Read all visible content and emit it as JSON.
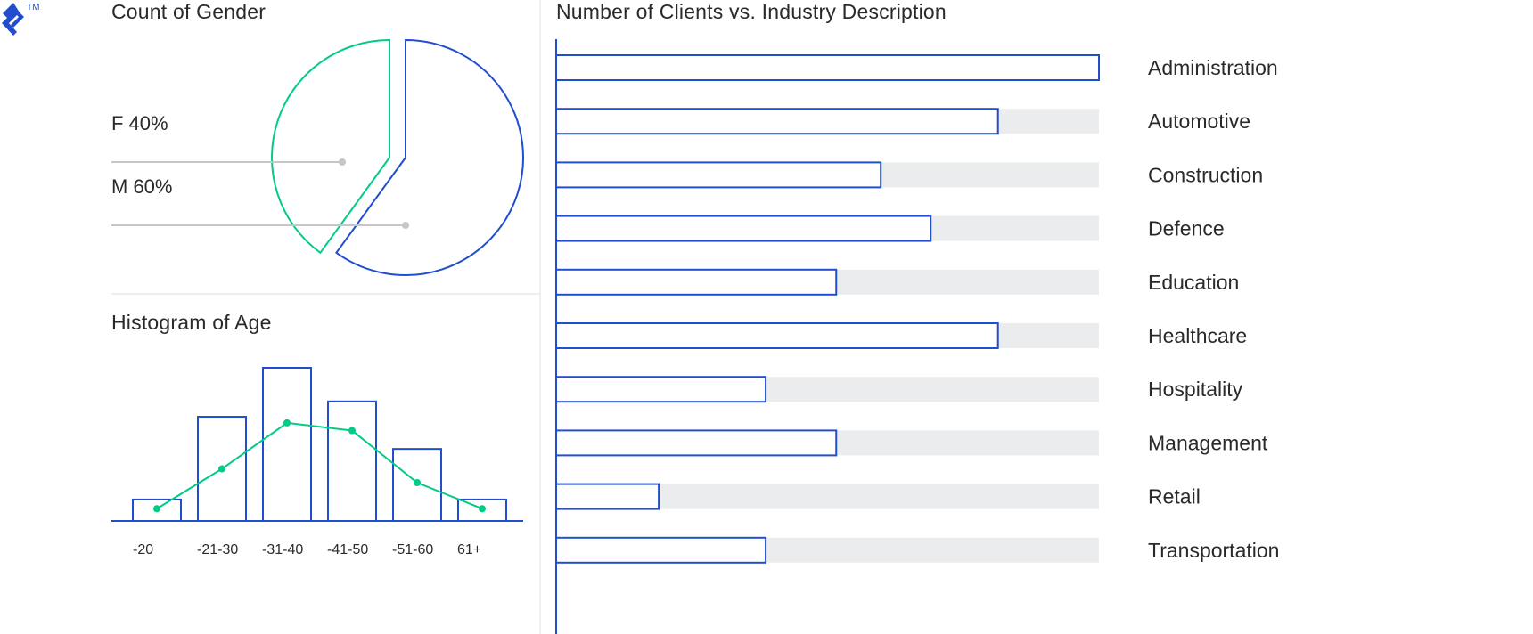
{
  "brand": {
    "logo_icon": "toptal-logo-icon",
    "trademark": "TM"
  },
  "colors": {
    "blue": "#204ECF",
    "green": "#00CC83",
    "track": "#EBECED",
    "pointer": "#C5C6C9"
  },
  "chart_data": [
    {
      "type": "pie",
      "title": "Count of Gender",
      "slices": [
        {
          "label": "F",
          "value": 40,
          "display": "F 40%"
        },
        {
          "label": "M",
          "value": 60,
          "display": "M 60%"
        }
      ]
    },
    {
      "type": "bar",
      "title": "Histogram of Age",
      "categories": [
        "-20",
        "-21-30",
        "-31-40",
        "-41-50",
        "-51-60",
        "61+"
      ],
      "series": [
        {
          "name": "bars",
          "values": [
            14,
            68,
            100,
            78,
            47,
            14
          ]
        },
        {
          "name": "line",
          "values": [
            8,
            34,
            64,
            59,
            25,
            8
          ]
        }
      ],
      "ylim": [
        0,
        100
      ],
      "xlabel": "",
      "ylabel": ""
    },
    {
      "type": "bar",
      "orientation": "horizontal",
      "title": "Number of Clients vs. Industry Description",
      "categories": [
        "Administration",
        "Automotive",
        "Construction",
        "Defence",
        "Education",
        "Healthcare",
        "Hospitality",
        "Management",
        "Retail",
        "Transportation"
      ],
      "values": [
        100,
        81.4,
        59.8,
        69,
        51.6,
        81.4,
        38.6,
        51.6,
        18.9,
        38.6
      ],
      "xlim": [
        0,
        100
      ],
      "xlabel": "",
      "ylabel": ""
    }
  ]
}
